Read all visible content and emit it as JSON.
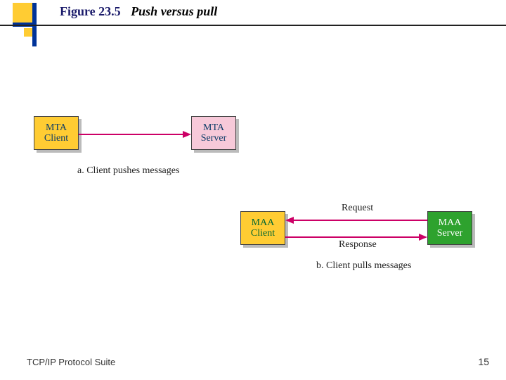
{
  "title": {
    "figure_label": "Figure 23.5",
    "caption": "Push versus pull"
  },
  "diagram_a": {
    "box_client_line1": "MTA",
    "box_client_line2": "Client",
    "box_server_line1": "MTA",
    "box_server_line2": "Server",
    "caption": "a. Client pushes messages"
  },
  "diagram_b": {
    "box_client_line1": "MAA",
    "box_client_line2": "Client",
    "box_server_line1": "MAA",
    "box_server_line2": "Server",
    "request_label": "Request",
    "response_label": "Response",
    "caption": "b. Client pulls messages"
  },
  "footer": "TCP/IP Protocol Suite",
  "page_number": "15",
  "colors": {
    "accent_blue": "#003399",
    "accent_yellow": "#ffcc33",
    "arrow_pink": "#cc0066",
    "box_mta_client": "#ffcc33",
    "box_mta_server": "#f7c9d9",
    "box_maa_client": "#ffcc33",
    "box_maa_server": "#2ea22e"
  }
}
